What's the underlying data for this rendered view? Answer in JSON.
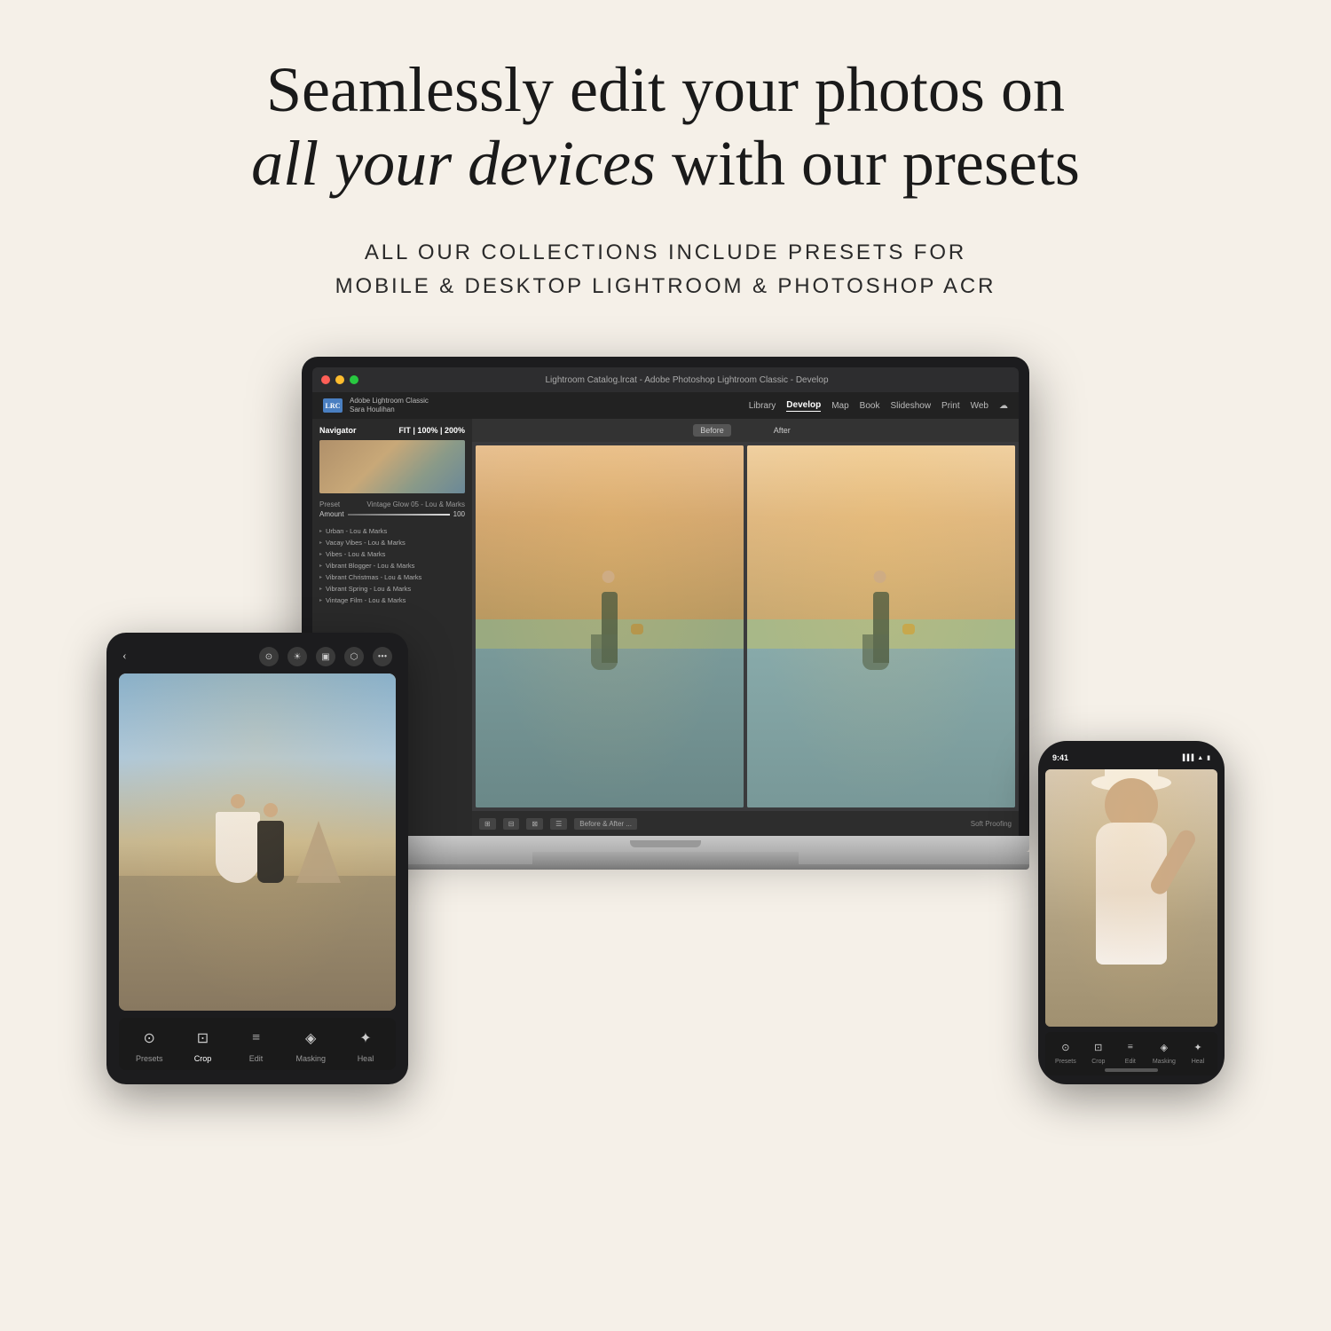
{
  "page": {
    "background_color": "#f5f0e8"
  },
  "headline": {
    "line1": "Seamlessly edit your photos on",
    "line2_italic": "all your devices",
    "line2_normal": " with our presets"
  },
  "subheadline": {
    "line1": "ALL OUR COLLECTIONS INCLUDE PRESETS FOR",
    "line2": "MOBILE & DESKTOP LIGHTROOM & PHOTOSHOP ACR"
  },
  "laptop": {
    "titlebar_text": "Lightroom Catalog.lrcat - Adobe Photoshop Lightroom Classic - Develop",
    "app_name": "Adobe Lightroom Classic",
    "user_name": "Sara Houlihan",
    "logo_text": "LRC",
    "nav_items": [
      "Library",
      "Develop",
      "Map",
      "Book",
      "Slideshow",
      "Print",
      "Web"
    ],
    "active_nav": "Develop",
    "navigator_label": "Navigator",
    "preset_name": "Vintage Glow 05 - Lou & Marks",
    "amount_label": "Amount",
    "amount_value": "100",
    "before_label": "Before",
    "after_label": "After",
    "before_and_after": "Before & After ...",
    "soft_proofing": "Soft Proofing",
    "preset_list": [
      "Urban - Lou & Marks",
      "Vacay Vibes - Lou & Marks",
      "Vibes - Lou & Marks",
      "Vibrant Blogger - Lou & Marks",
      "Vibrant Christmas - Lou & Marks",
      "Vibrant Spring - Lou & Marks",
      "Vintage Film - Lou & Marks"
    ]
  },
  "tablet": {
    "tools": [
      {
        "label": "Presets",
        "icon": "⊙"
      },
      {
        "label": "Crop",
        "icon": "⊡"
      },
      {
        "label": "Edit",
        "icon": "≡"
      },
      {
        "label": "Masking",
        "icon": "◈"
      },
      {
        "label": "Heal",
        "icon": "✦"
      }
    ]
  },
  "phone": {
    "time": "9:41",
    "tools": [
      {
        "label": "Presets",
        "icon": "⊙"
      },
      {
        "label": "Crop",
        "icon": "⊡"
      },
      {
        "label": "Edit",
        "icon": "≡"
      },
      {
        "label": "Masking",
        "icon": "◈"
      },
      {
        "label": "Heal",
        "icon": "✦"
      }
    ]
  }
}
